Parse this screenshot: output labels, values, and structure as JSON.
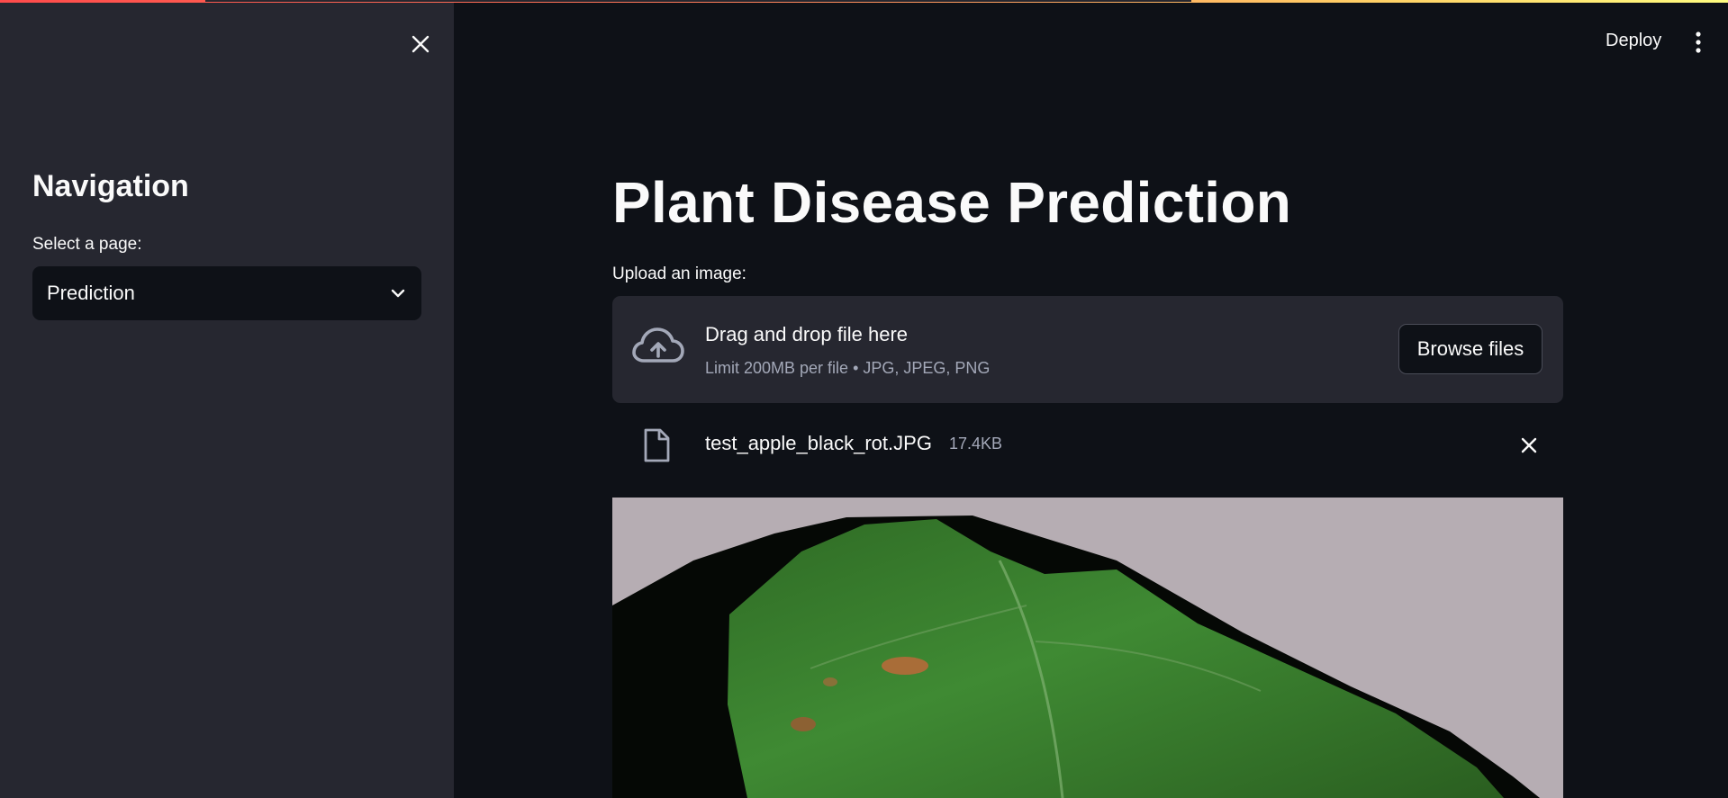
{
  "sidebar": {
    "heading": "Navigation",
    "select_label": "Select a page:",
    "selected_page": "Prediction"
  },
  "header": {
    "deploy_label": "Deploy"
  },
  "main": {
    "title": "Plant Disease Prediction",
    "upload_label": "Upload an image:",
    "dropzone": {
      "title": "Drag and drop file here",
      "limits": "Limit 200MB per file • JPG, JPEG, PNG",
      "browse_label": "Browse files"
    },
    "uploaded_file": {
      "name": "test_apple_black_rot.JPG",
      "size": "17.4KB"
    }
  },
  "icons": {
    "sidebar_close": "close-icon",
    "menu": "kebab-menu-icon",
    "select_caret": "chevron-down-icon",
    "upload": "cloud-upload-icon",
    "file": "file-icon",
    "remove_file": "close-icon"
  },
  "colors": {
    "app_background": "#0e1117",
    "sidebar_background": "#262730",
    "text_primary": "#fafafa",
    "text_muted": "#a3a8b8",
    "accent_gradient_start": "#ff4b4b",
    "accent_gradient_end": "#fffd80"
  }
}
